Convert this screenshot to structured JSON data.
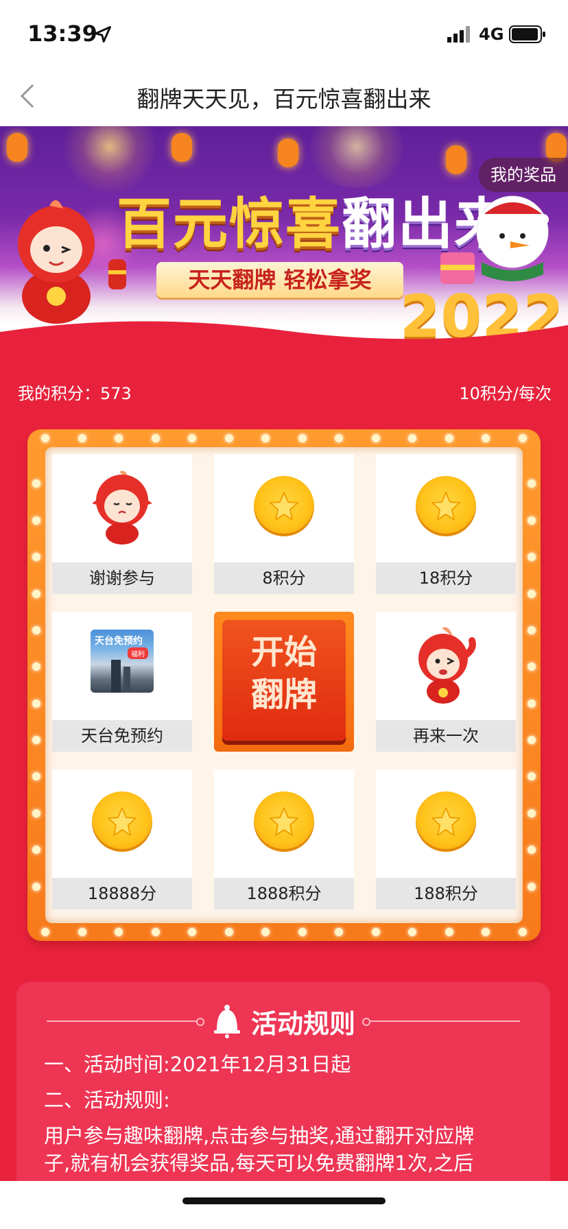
{
  "status_bar": {
    "time": "13:39",
    "network": "4G",
    "icons": [
      "location-arrow-icon",
      "signal-icon",
      "battery-icon"
    ]
  },
  "nav": {
    "title": "翻牌天天见，百元惊喜翻出来",
    "back_icon": "chevron-left-icon"
  },
  "banner": {
    "title_gold": "百元惊喜",
    "title_white": "翻出来",
    "subtitle": "天天翻牌 轻松拿奖",
    "year": "2022",
    "prizes_button": "我的奖品"
  },
  "stats": {
    "points_label": "我的积分：573",
    "cost_label": "10积分/每次"
  },
  "grid": {
    "cards": [
      {
        "label": "谢谢参与",
        "icon": "mascot-icon"
      },
      {
        "label": "8积分",
        "icon": "coin-icon"
      },
      {
        "label": "18积分",
        "icon": "coin-icon"
      },
      {
        "label": "天台免预约",
        "icon": "rooftop-coupon-icon",
        "thumb_title": "天台免预约",
        "thumb_tag": "福利"
      },
      {
        "label": "开始\n翻牌",
        "icon": "start-button"
      },
      {
        "label": "再来一次",
        "icon": "mascot-wave-icon"
      },
      {
        "label": "18888分",
        "icon": "coin-icon"
      },
      {
        "label": "1888积分",
        "icon": "coin-icon"
      },
      {
        "label": "188积分",
        "icon": "coin-icon"
      }
    ]
  },
  "rules": {
    "title": "活动规则",
    "icon": "bell-icon",
    "lines": [
      "一、活动时间:2021年12月31日起",
      "二、活动规则:",
      "用户参与趣味翻牌,点击参与抽奖,通过翻开对应牌",
      "子,就有机会获得奖品,每天可以免费翻牌1次,之后"
    ]
  },
  "colors": {
    "page_red": "#e8223c",
    "board_orange": "#f7841f",
    "coin_gold": "#ffc21a"
  }
}
